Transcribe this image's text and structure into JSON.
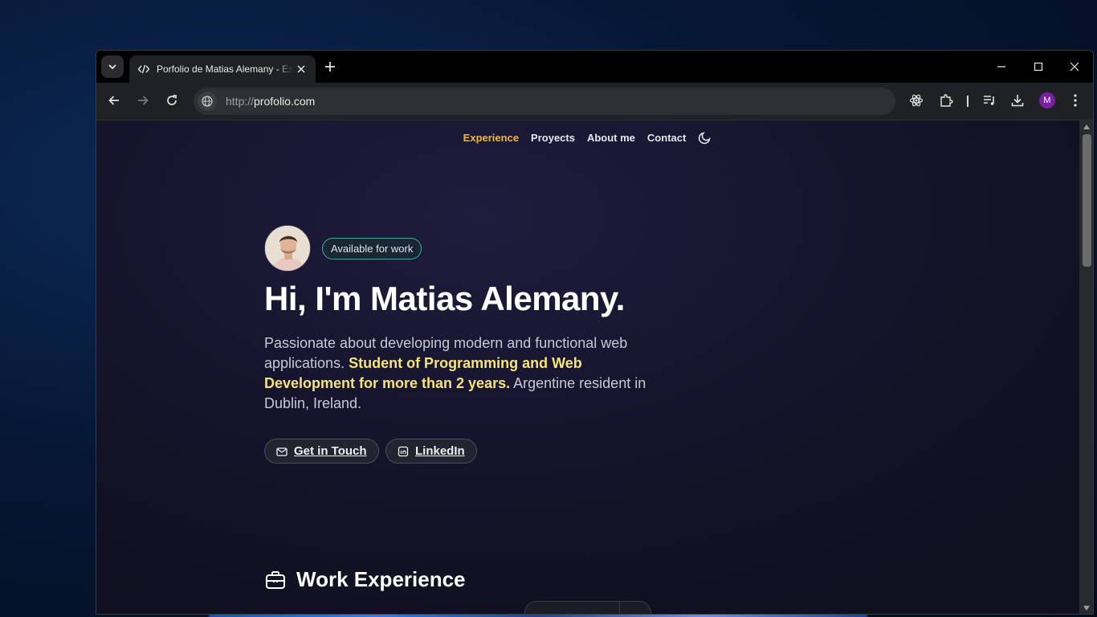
{
  "browser": {
    "tab": {
      "title": "Porfolio de Matias Alemany - Es"
    },
    "url": {
      "scheme": "http://",
      "host": "profolio.com"
    },
    "profile_initial": "M"
  },
  "site": {
    "nav": {
      "items": [
        {
          "label": "Experience",
          "active": true
        },
        {
          "label": "Proyects",
          "active": false
        },
        {
          "label": "About me",
          "active": false
        },
        {
          "label": "Contact",
          "active": false
        }
      ]
    },
    "badge": "Available for work",
    "heading": "Hi, I'm Matias Alemany.",
    "intro": {
      "part1": "Passionate about developing modern and functional web applications. ",
      "highlight": "Student of Programming and Web Development for more than 2 years.",
      "part2": " Argentine resident in Dublin, Ireland."
    },
    "buttons": {
      "contact": "Get in Touch",
      "linkedin": "LinkedIn"
    },
    "section_title": "Work Experience"
  },
  "colors": {
    "accent": "#f5b731",
    "highlight": "#f5e47a",
    "badge_border": "#3fae93"
  }
}
